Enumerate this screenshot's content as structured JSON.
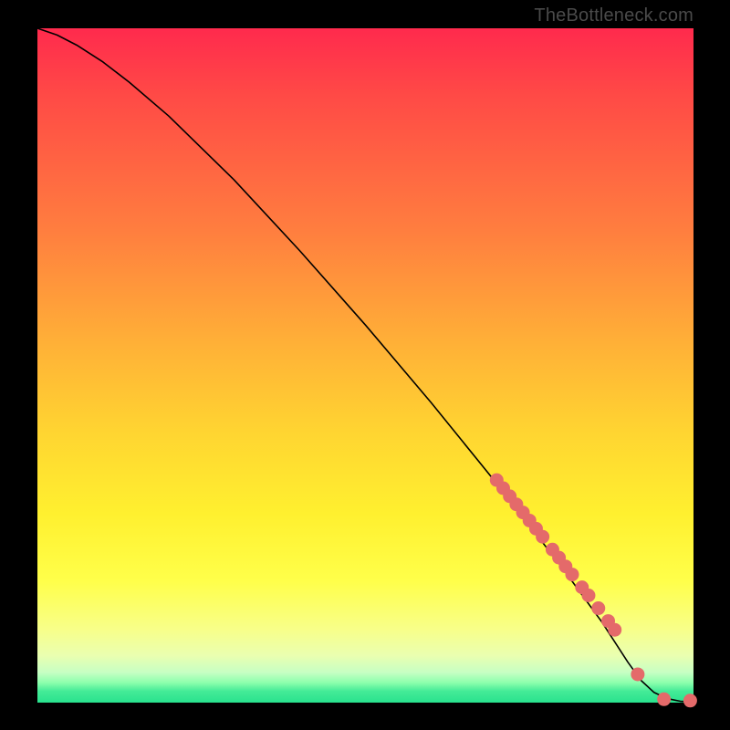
{
  "attribution": "TheBottleneck.com",
  "chart_data": {
    "type": "line",
    "title": "",
    "xlabel": "",
    "ylabel": "",
    "xlim": [
      0,
      100
    ],
    "ylim": [
      0,
      100
    ],
    "grid": false,
    "legend": false,
    "series": [
      {
        "name": "curve",
        "x": [
          0,
          3,
          6,
          10,
          14,
          20,
          30,
          40,
          50,
          60,
          70,
          80,
          86,
          90,
          92,
          94,
          96,
          98,
          100
        ],
        "y": [
          100,
          99,
          97.5,
          95,
          92,
          87,
          77.5,
          67,
          56,
          44.5,
          32.5,
          20,
          12,
          6,
          3.3,
          1.5,
          0.6,
          0.2,
          0.1
        ]
      }
    ],
    "markers": {
      "name": "highlighted-points",
      "color": "#e46a6a",
      "x": [
        70,
        71,
        72,
        73,
        74,
        75,
        76,
        77,
        78.5,
        79.5,
        80.5,
        81.5,
        83,
        84,
        85.5,
        87,
        88,
        91.5,
        95.5,
        99.5
      ],
      "y": [
        33.0,
        31.8,
        30.6,
        29.4,
        28.2,
        27.0,
        25.8,
        24.6,
        22.7,
        21.5,
        20.2,
        19.0,
        17.1,
        15.9,
        14.0,
        12.1,
        10.8,
        4.2,
        0.5,
        0.3
      ]
    }
  }
}
